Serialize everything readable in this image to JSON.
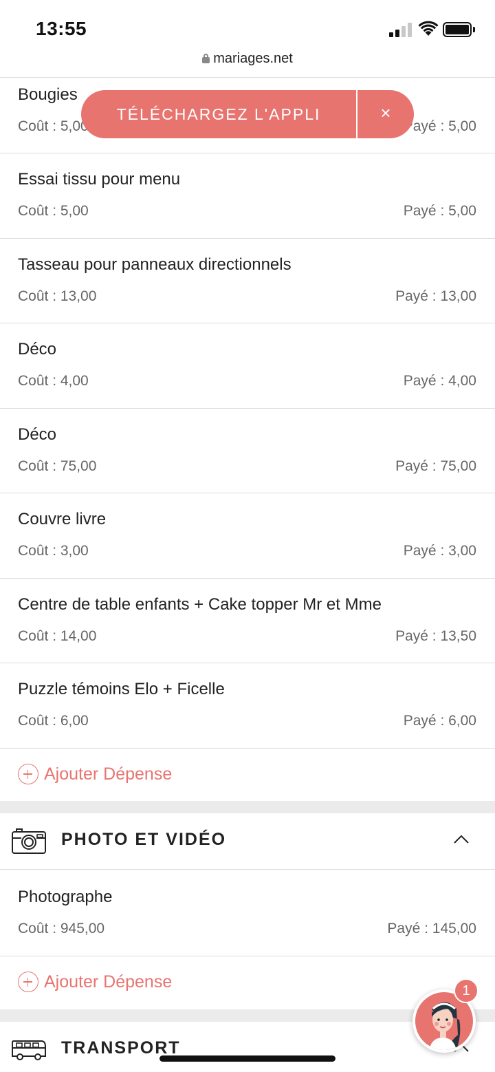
{
  "status_bar": {
    "time": "13:55"
  },
  "browser": {
    "url": "mariages.net"
  },
  "app_banner": {
    "label": "TÉLÉCHARGEZ L'APPLI",
    "close": "×"
  },
  "expenses": [
    {
      "name": "Bougies",
      "cost": "Coût : 5,00",
      "paid": "Payé : 5,00"
    },
    {
      "name": "Essai tissu pour menu",
      "cost": "Coût : 5,00",
      "paid": "Payé : 5,00"
    },
    {
      "name": "Tasseau pour panneaux directionnels",
      "cost": "Coût : 13,00",
      "paid": "Payé : 13,00"
    },
    {
      "name": "Déco",
      "cost": "Coût : 4,00",
      "paid": "Payé : 4,00"
    },
    {
      "name": "Déco",
      "cost": "Coût : 75,00",
      "paid": "Payé : 75,00"
    },
    {
      "name": "Couvre livre",
      "cost": "Coût : 3,00",
      "paid": "Payé : 3,00"
    },
    {
      "name": "Centre de table enfants + Cake topper Mr et Mme",
      "cost": "Coût : 14,00",
      "paid": "Payé : 13,50"
    },
    {
      "name": "Puzzle témoins Elo + Ficelle",
      "cost": "Coût : 6,00",
      "paid": "Payé : 6,00"
    }
  ],
  "add_expense_label": "Ajouter Dépense",
  "sections": {
    "photo": {
      "title": "PHOTO ET VIDÉO",
      "icon": "camera-icon",
      "items": [
        {
          "name": "Photographe",
          "cost": "Coût : 945,00",
          "paid": "Payé : 145,00"
        }
      ],
      "add_label": "Ajouter Dépense"
    },
    "transport": {
      "title": "TRANSPORT",
      "icon": "bus-icon"
    }
  },
  "chat": {
    "badge_count": "1"
  },
  "colors": {
    "accent": "#e87470",
    "divider": "#dcdcdc",
    "section_gap": "#ebebeb"
  }
}
